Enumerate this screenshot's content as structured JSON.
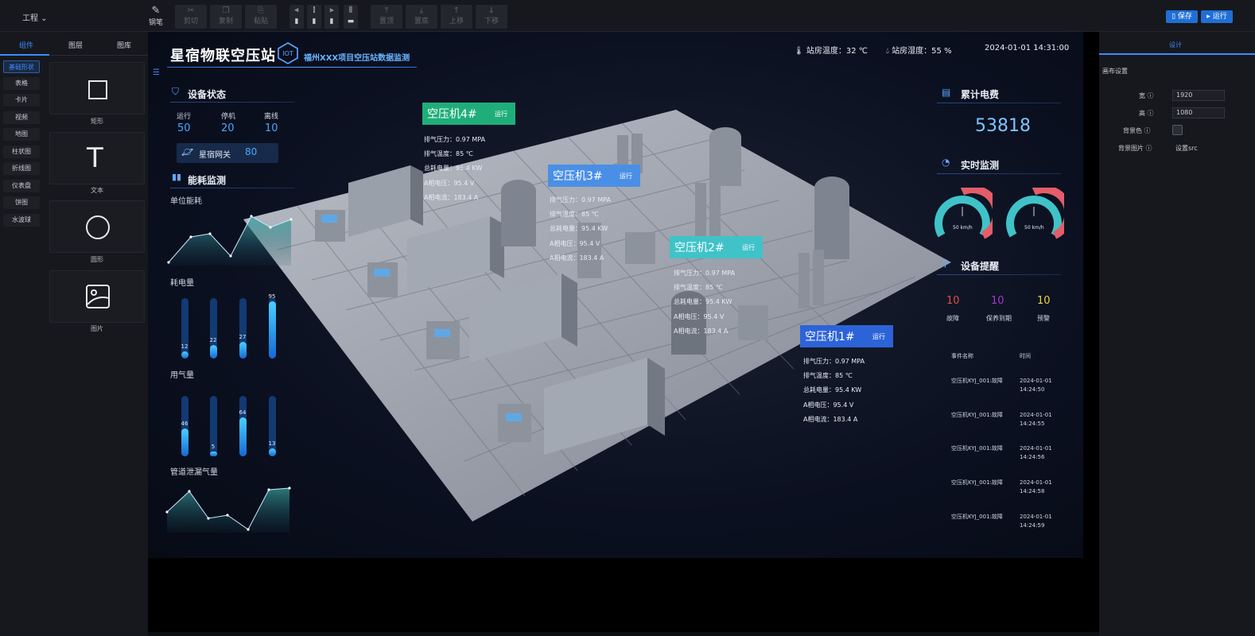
{
  "toolbar": {
    "project": "工程",
    "pen": "钢笔",
    "cut": "剪切",
    "copy": "复制",
    "paste": "粘贴",
    "top": "置顶",
    "bottom": "置底",
    "up": "上移",
    "down": "下移",
    "save": "保存",
    "run": "运行"
  },
  "left": {
    "tabs": [
      "组件",
      "图层",
      "图库"
    ],
    "categories": [
      "基础形状",
      "表格",
      "卡片",
      "视频",
      "地图",
      "柱状图",
      "折线图",
      "仪表盘",
      "饼图",
      "水波球"
    ],
    "components": [
      "矩形",
      "文本",
      "圆形",
      "图片"
    ]
  },
  "right": {
    "tab": "设计",
    "section": "画布设置",
    "width_label": "宽",
    "width_value": "1920",
    "height_label": "高",
    "height_value": "1080",
    "bgcolor_label": "背景色",
    "bgimage_label": "背景图片",
    "bgimage_value": "设置src"
  },
  "screen": {
    "title": "星宿物联空压站",
    "logo_text": "IOT",
    "subtitle": "福州XXX项目空压站数据监测",
    "temp_label": "站房温度：32 ℃",
    "humidity_label": "站房湿度：55 %",
    "datetime": "2024-01-01 14:31:00",
    "device_status": {
      "title": "设备状态",
      "items": [
        {
          "label": "运行",
          "value": "50"
        },
        {
          "label": "停机",
          "value": "20"
        },
        {
          "label": "离线",
          "value": "10"
        }
      ],
      "gateway_label": "星宿网关",
      "gateway_value": "80"
    },
    "energy": {
      "title": "能耗监测",
      "unit_title": "单位能耗",
      "power_title": "耗电量",
      "power_values": [
        12,
        22,
        27,
        95
      ],
      "gas_title": "用气量",
      "gas_values": [
        46,
        5,
        64,
        13
      ],
      "leak_title": "管道泄漏气量"
    },
    "machines": [
      {
        "name": "空压机4#",
        "status": "运行",
        "color": "#1fae7a"
      },
      {
        "name": "空压机3#",
        "status": "运行",
        "color": "#4a8fe6"
      },
      {
        "name": "空压机2#",
        "status": "运行",
        "color": "#3fc3c8"
      },
      {
        "name": "空压机1#",
        "status": "运行",
        "color": "#2d63d8"
      }
    ],
    "machine_info": {
      "pressure": "排气压力：0.97 MPA",
      "temp": "排气温度：85 ℃",
      "power": "总耗电量：95.4 KW",
      "voltage": "A相电压：95.4 V",
      "current": "A相电流：183.4 A"
    },
    "cost": {
      "title": "累计电费",
      "value": "53818"
    },
    "realtime": {
      "title": "实时监测",
      "gauge1": "50 km/h",
      "gauge2": "50 km/h"
    },
    "alerts": {
      "title": "设备提醒",
      "items": [
        {
          "value": "10",
          "label": "故障",
          "color": "#e04a4a"
        },
        {
          "value": "10",
          "label": "保养到期",
          "color": "#a23ad4"
        },
        {
          "value": "10",
          "label": "预警",
          "color": "#f2d33c"
        }
      ],
      "col_event": "事件名称",
      "col_time": "时间",
      "events": [
        {
          "name": "空压机KYJ_001:故障",
          "date": "2024-01-01",
          "time": "14:24:50"
        },
        {
          "name": "空压机KYJ_001:故障",
          "date": "2024-01-01",
          "time": "14:24:55"
        },
        {
          "name": "空压机KYJ_001:故障",
          "date": "2024-01-01",
          "time": "14:24:56"
        },
        {
          "name": "空压机KYJ_001:故障",
          "date": "2024-01-01",
          "time": "14:24:58"
        },
        {
          "name": "空压机KYJ_001:故障",
          "date": "2024-01-01",
          "time": "14:24:59"
        }
      ]
    }
  }
}
